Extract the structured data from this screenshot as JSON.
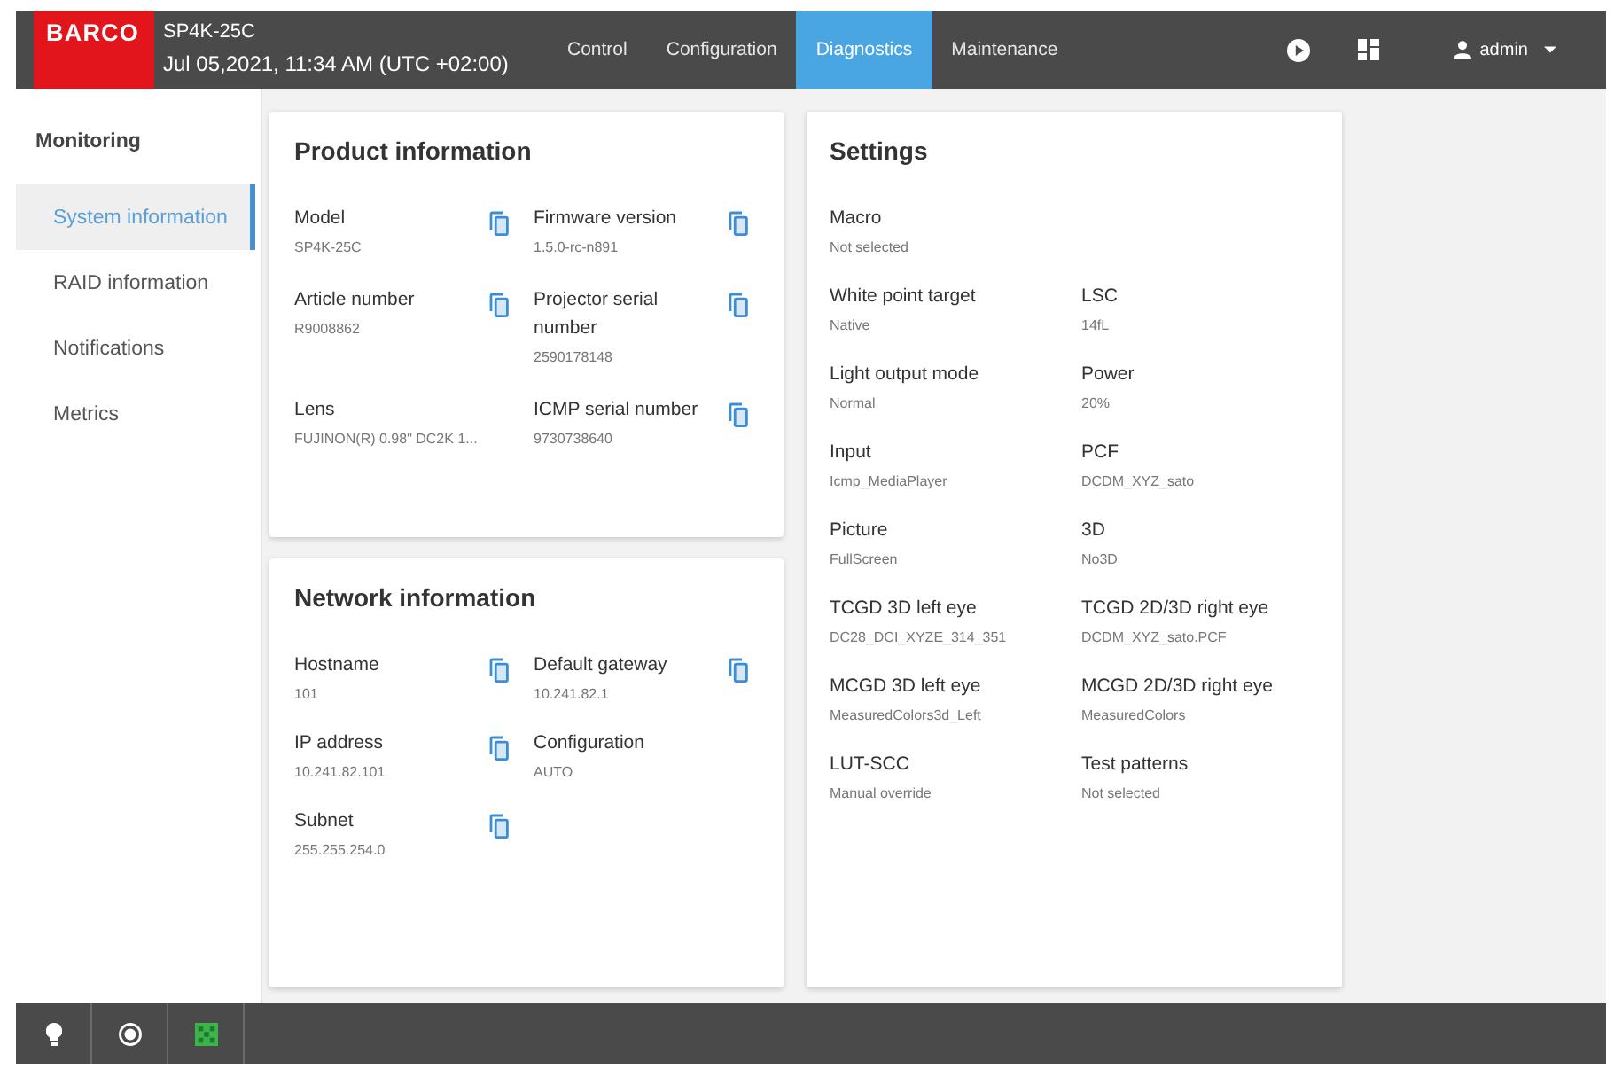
{
  "header": {
    "logo": "BARCO",
    "device": "SP4K-25C",
    "datetime": "Jul 05,2021, 11:34 AM (UTC +02:00)",
    "tabs": [
      {
        "label": "Control",
        "selected": false
      },
      {
        "label": "Configuration",
        "selected": false
      },
      {
        "label": "Diagnostics",
        "selected": true
      },
      {
        "label": "Maintenance",
        "selected": false
      }
    ],
    "user": "admin"
  },
  "sidebar": {
    "title": "Monitoring",
    "items": [
      {
        "label": "System information",
        "selected": true
      },
      {
        "label": "RAID information",
        "selected": false
      },
      {
        "label": "Notifications",
        "selected": false
      },
      {
        "label": "Metrics",
        "selected": false
      }
    ]
  },
  "product_information": {
    "title": "Product information",
    "fields": [
      {
        "label": "Model",
        "value": "SP4K-25C",
        "copy": true
      },
      {
        "label": "Firmware version",
        "value": "1.5.0-rc-n891",
        "copy": true
      },
      {
        "label": "Article number",
        "value": "R9008862",
        "copy": true
      },
      {
        "label": "Projector serial number",
        "value": "2590178148",
        "copy": true
      },
      {
        "label": "Lens",
        "value": "FUJINON(R) 0.98\" DC2K 1...",
        "copy": false
      },
      {
        "label": "ICMP serial number",
        "value": "9730738640",
        "copy": true
      }
    ]
  },
  "network_information": {
    "title": "Network information",
    "fields": [
      {
        "label": "Hostname",
        "value": "101",
        "copy": true
      },
      {
        "label": "Default gateway",
        "value": "10.241.82.1",
        "copy": true
      },
      {
        "label": "IP address",
        "value": "10.241.82.101",
        "copy": true
      },
      {
        "label": "Configuration",
        "value": "AUTO",
        "copy": false
      },
      {
        "label": "Subnet",
        "value": "255.255.254.0",
        "copy": true
      }
    ]
  },
  "settings": {
    "title": "Settings",
    "rows": [
      {
        "fields": [
          {
            "label": "Macro",
            "value": "Not selected"
          }
        ]
      },
      {
        "fields": [
          {
            "label": "White point target",
            "value": "Native"
          },
          {
            "label": "LSC",
            "value": "14fL"
          }
        ]
      },
      {
        "fields": [
          {
            "label": "Light output mode",
            "value": "Normal"
          },
          {
            "label": "Power",
            "value": "20%"
          }
        ]
      },
      {
        "fields": [
          {
            "label": "Input",
            "value": "Icmp_MediaPlayer"
          },
          {
            "label": "PCF",
            "value": "DCDM_XYZ_sato"
          }
        ]
      },
      {
        "fields": [
          {
            "label": "Picture",
            "value": "FullScreen"
          },
          {
            "label": "3D",
            "value": "No3D"
          }
        ]
      },
      {
        "fields": [
          {
            "label": "TCGD 3D left eye",
            "value": "DC28_DCI_XYZE_314_351"
          },
          {
            "label": "TCGD 2D/3D right eye",
            "value": "DCDM_XYZ_sato.PCF"
          }
        ]
      },
      {
        "fields": [
          {
            "label": "MCGD 3D left eye",
            "value": "MeasuredColors3d_Left"
          },
          {
            "label": "MCGD 2D/3D right eye",
            "value": "MeasuredColors"
          }
        ]
      },
      {
        "fields": [
          {
            "label": "LUT-SCC",
            "value": "Manual override"
          },
          {
            "label": "Test patterns",
            "value": "Not selected"
          }
        ]
      }
    ]
  }
}
